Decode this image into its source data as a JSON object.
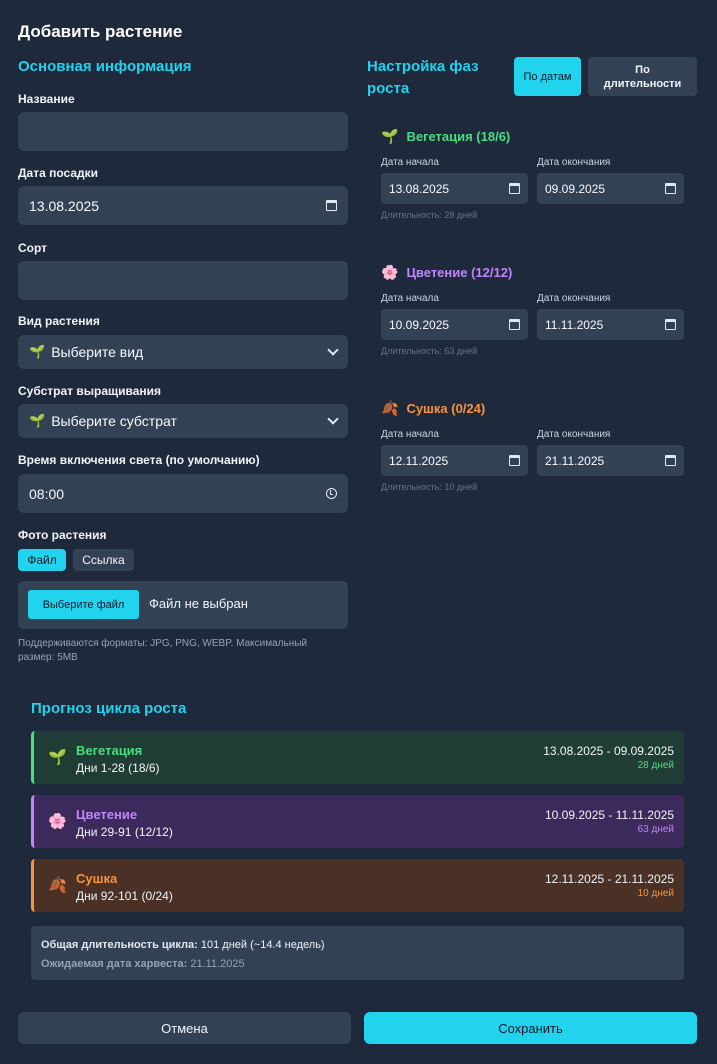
{
  "modal_title": "Добавить растение",
  "basic": {
    "section_title": "Основная информация",
    "name_label": "Название",
    "name_value": "",
    "planting_date_label": "Дата посадки",
    "planting_date_value": "13.08.2025",
    "strain_label": "Сорт",
    "strain_value": "",
    "plant_type_label": "Вид растения",
    "plant_type_value": "Выберите вид",
    "substrate_label": "Субстрат выращивания",
    "substrate_value": "Выберите субстрат",
    "light_time_label": "Время включения света (по умолчанию)",
    "light_time_value": "08:00",
    "photo_label": "Фото растения",
    "photo_tab_file": "Файл",
    "photo_tab_link": "Ссылка",
    "choose_file_button": "Выберите файл",
    "no_file_text": "Файл не выбран",
    "formats_hint": "Поддерживаются форматы: JPG, PNG, WEBP. Максимальный размер: 5MB"
  },
  "phases_config": {
    "section_title": "Настройка фаз роста",
    "mode_by_dates": "По датам",
    "mode_by_duration": "По длительности",
    "start_label": "Дата начала",
    "end_label": "Дата окончания",
    "phases": [
      {
        "name": "Вегетация (18/6)",
        "color": "#4ade80",
        "icon": "sprout-icon",
        "start": "13.08.2025",
        "end": "09.09.2025",
        "duration": "Длительность: 28 дней"
      },
      {
        "name": "Цветение (12/12)",
        "color": "#c084fc",
        "icon": "flower-icon",
        "start": "10.09.2025",
        "end": "11.11.2025",
        "duration": "Длительность: 63 дней"
      },
      {
        "name": "Сушка (0/24)",
        "color": "#fb923c",
        "icon": "leaves-icon",
        "start": "12.11.2025",
        "end": "21.11.2025",
        "duration": "Длительность: 10 дней"
      }
    ]
  },
  "forecast": {
    "section_title": "Прогноз цикла роста",
    "cards": [
      {
        "name": "Вегетация",
        "days": "Дни 1-28 (18/6)",
        "range": "13.08.2025 - 09.09.2025",
        "count": "28 дней",
        "color": "#4ade80",
        "bg": "#1f3d34"
      },
      {
        "name": "Цветение",
        "days": "Дни 29-91 (12/12)",
        "range": "10.09.2025 - 11.11.2025",
        "count": "63 дней",
        "color": "#c084fc",
        "bg": "#3b2a5b"
      },
      {
        "name": "Сушка",
        "days": "Дни 92-101 (0/24)",
        "range": "12.11.2025 - 21.11.2025",
        "count": "10 дней",
        "color": "#fb923c",
        "bg": "#4a3025"
      }
    ],
    "total_label": "Общая длительность цикла:",
    "total_value": "101 дней (~14.4 недель)",
    "harvest_label": "Ожидаемая дата харвеста:",
    "harvest_value": "21.11.2025"
  },
  "footer": {
    "cancel_button": "Отмена",
    "save_button": "Сохранить"
  }
}
